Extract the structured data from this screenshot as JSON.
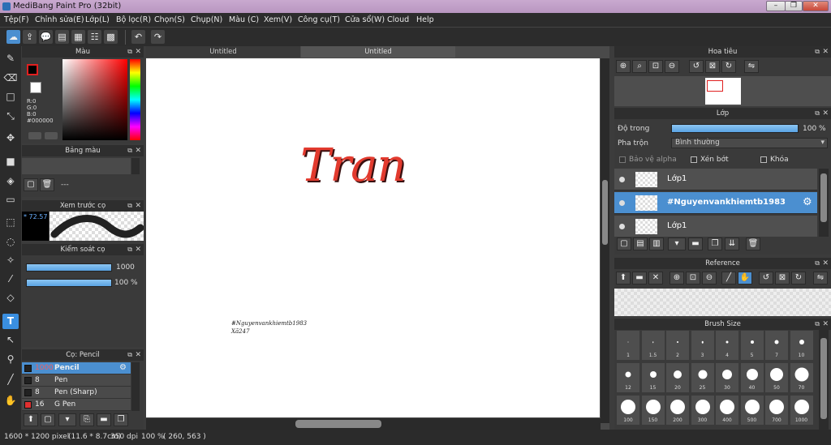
{
  "window": {
    "title": "MediBang Paint Pro (32bit)"
  },
  "menu": [
    "Tệp(F)",
    "Chỉnh sửa(E)",
    "Lớp(L)",
    "Bộ lọc(R)",
    "Chọn(S)",
    "Chụp(N)",
    "Màu (C)",
    "Xem(V)",
    "Công cụ(T)",
    "Cửa sổ(W)",
    "Cloud",
    "Help"
  ],
  "color_panel": {
    "title": "Màu",
    "r": "R:0",
    "g": "G:0",
    "b": "B:0",
    "hex": "#000000",
    "current": "#000000"
  },
  "palette_panel": {
    "title": "Bảng màu",
    "value": "---"
  },
  "brush_preview": {
    "title": "Xem trước cọ",
    "size": "72.57"
  },
  "brush_control": {
    "title": "Kiểm soát cọ",
    "size_value": "1000",
    "opacity_value": "100 %"
  },
  "brush_list": {
    "title": "Cọ: Pencil",
    "items": [
      {
        "size": "1000",
        "name": "Pencil",
        "color": "#111111"
      },
      {
        "size": "8",
        "name": "Pen",
        "color": "#111111"
      },
      {
        "size": "8",
        "name": "Pen (Sharp)",
        "color": "#111111"
      },
      {
        "size": "16",
        "name": "G Pen",
        "color": "#e03030"
      }
    ]
  },
  "tabs": [
    "Untitled",
    "Untitled"
  ],
  "canvas": {
    "main_text": "Tran",
    "small_text_1": "#Nguyenvankhiemtb1983",
    "small_text_2": "Xã247"
  },
  "navigator": {
    "title": "Hoa tiêu"
  },
  "layers": {
    "title": "Lớp",
    "opacity_label": "Độ trong",
    "opacity_value": "100 %",
    "opacity_fraction": 1.0,
    "blend_label": "Pha trộn",
    "blend_value": "Bình thường",
    "protect_alpha": "Bảo vệ alpha",
    "clipping": "Xén bớt",
    "lock": "Khóa",
    "items": [
      {
        "name": "Lớp1",
        "selected": false
      },
      {
        "name": "#Nguyenvankhiemtb1983",
        "selected": true
      },
      {
        "name": "Lớp1",
        "selected": false
      }
    ]
  },
  "reference": {
    "title": "Reference"
  },
  "brush_size": {
    "title": "Brush Size",
    "sizes": [
      "1",
      "1.5",
      "2",
      "3",
      "4",
      "5",
      "7",
      "10",
      "12",
      "15",
      "20",
      "25",
      "30",
      "40",
      "50",
      "70",
      "100",
      "150",
      "200",
      "300",
      "400",
      "500",
      "700",
      "1000"
    ]
  },
  "status": {
    "dimensions": "1600 * 1200 pixel",
    "physical": "(11.6 * 8.7cm)",
    "dpi": "350 dpi",
    "zoom": "100 %",
    "cursor": "( 260, 563 )"
  },
  "accent": "#4b8fd0"
}
